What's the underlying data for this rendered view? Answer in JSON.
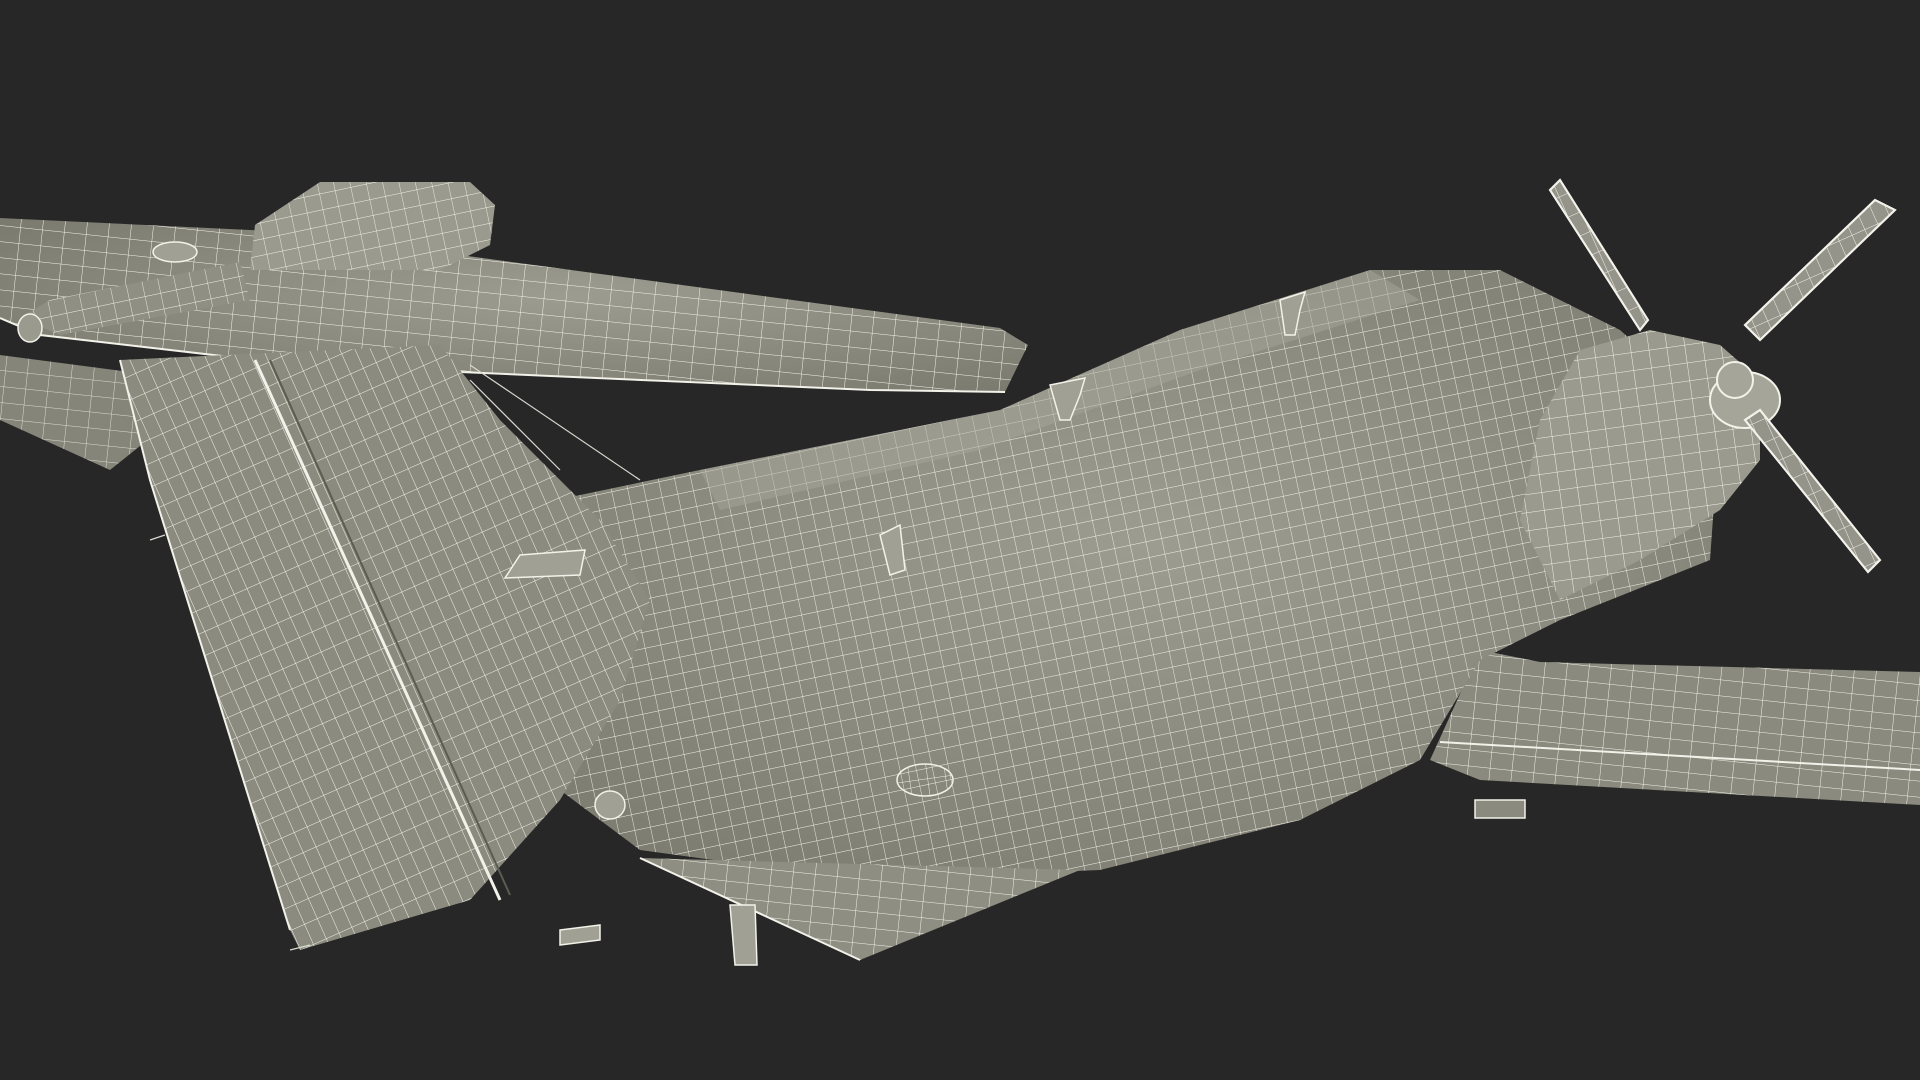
{
  "scene": {
    "subject": "turboprop-aircraft-wireframe",
    "view": "rear-left-low"
  },
  "colors": {
    "background": "#272727",
    "surface": "#8c8c80",
    "surface_light": "#a3a396",
    "surface_dark": "#6f6f64",
    "wire": "#f2f2ea"
  }
}
